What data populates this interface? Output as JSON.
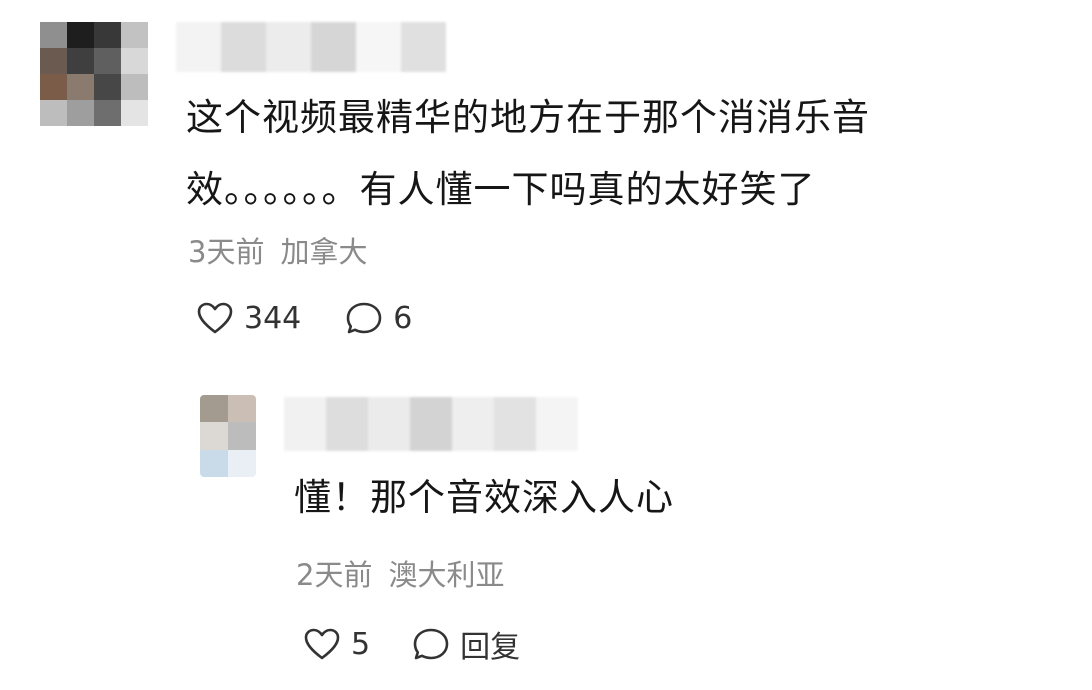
{
  "comments": [
    {
      "text": "这个视频最精华的地方在于那个消消乐音效。。。。。。有人懂一下吗真的太好笑了",
      "time": "3天前",
      "location": "加拿大",
      "likes": "344",
      "replies": "6",
      "avatar_icon": "pixelated-avatar-icon",
      "avatar_colors": [
        "#8f8f8f",
        "#1e1e1e",
        "#383838",
        "#c2c2c2",
        "#6b5a4f",
        "#3f3f3f",
        "#5f5f5f",
        "#d8d8d8",
        "#7a5c48",
        "#8b7b6e",
        "#474747",
        "#bdbdbd",
        "#bdbdbd",
        "#9e9e9e",
        "#6e6e6e",
        "#e4e4e4"
      ],
      "name_colors": [
        "#f3f3f3",
        "#dcdcdc",
        "#ececec",
        "#d6d6d6",
        "#f6f6f6",
        "#e0e0e0"
      ],
      "reply": {
        "text": "懂！那个音效深入人心",
        "time": "2天前",
        "location": "澳大利亚",
        "likes": "5",
        "reply_label": "回复",
        "avatar_icon": "pixelated-avatar-icon",
        "avatar_colors": [
          "#a39a90",
          "#cbbfb5",
          "#dcd8d4",
          "#bcbcbc",
          "#c9dbe9",
          "#e9eff4"
        ],
        "name_colors": [
          "#f1f1f1",
          "#dddddd",
          "#ebebeb",
          "#d3d3d3",
          "#eeeeee",
          "#e2e2e2",
          "#f4f4f4"
        ]
      }
    }
  ],
  "icons": {
    "like": "heart-outline-icon",
    "comment": "speech-bubble-icon"
  }
}
